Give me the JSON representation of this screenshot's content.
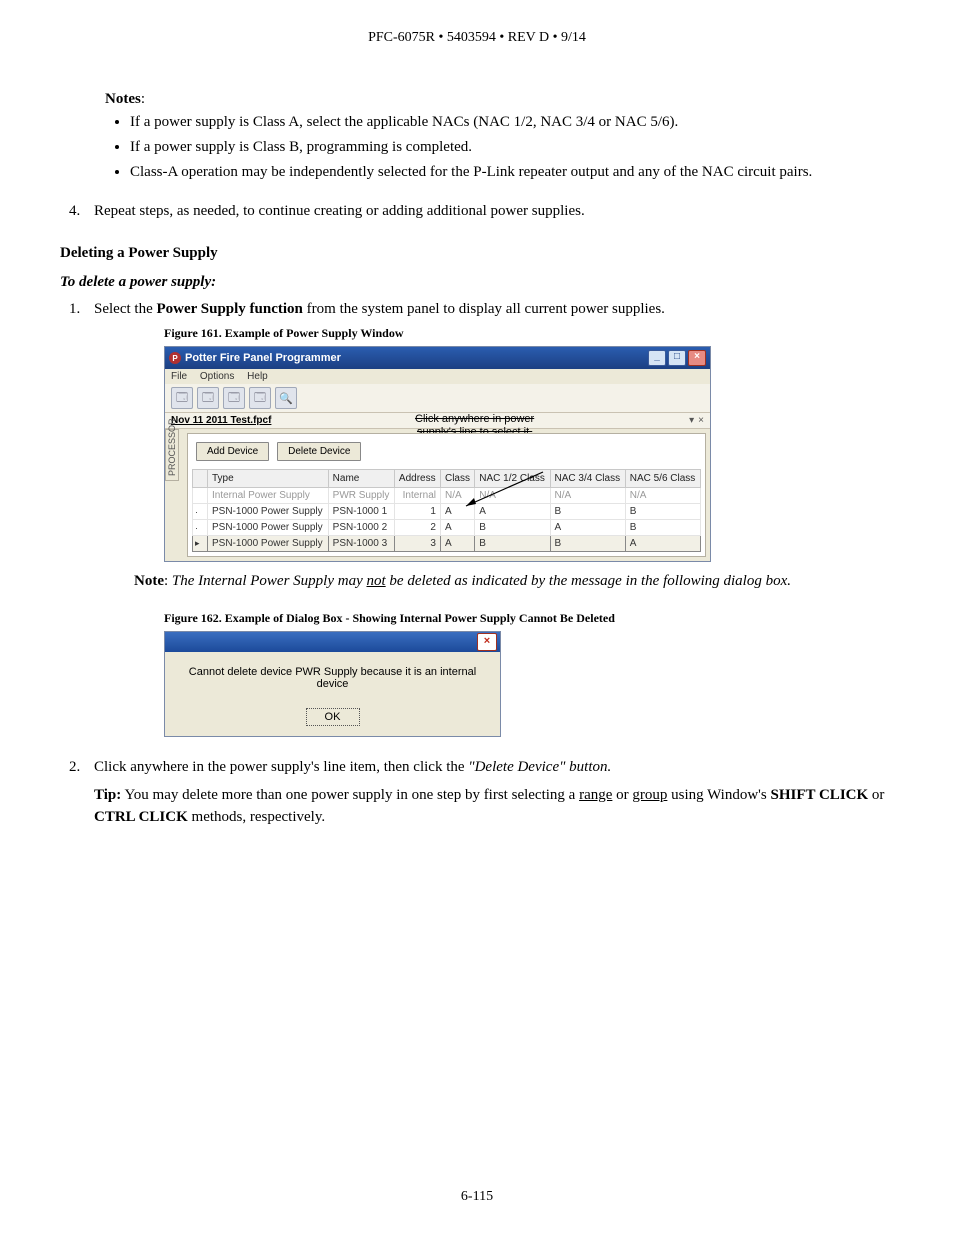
{
  "header": "PFC-6075R • 5403594 • REV D • 9/14",
  "notesLabel": "Notes",
  "notes": [
    "If a power supply is Class A, select the applicable NACs (NAC 1/2, NAC 3/4 or NAC 5/6).",
    "If a power supply is Class B, programming is completed.",
    "Class-A operation may be independently selected for the P-Link repeater output and any of the NAC circuit pairs."
  ],
  "step4": "Repeat steps, as needed, to continue creating or adding additional power supplies.",
  "deleteHeading": "Deleting a Power Supply",
  "deleteSub": "To delete a power supply:",
  "step1a": "Select the ",
  "step1b": "Power Supply function",
  "step1c": " from the system panel to display all current power supplies.",
  "fig161": "Figure 161. Example of  Power Supply Window",
  "app": {
    "title": "Potter Fire Panel Programmer",
    "menu": {
      "file": "File",
      "options": "Options",
      "help": "Help"
    },
    "doc": "Nov 11 2011 Test.fpcf",
    "calloutL1": "Click anywhere in power",
    "calloutL2": "supply's line to select it.",
    "sideTab": "PROCESSOR",
    "addBtn": "Add Device",
    "delBtn": "Delete Device",
    "cols": {
      "type": "Type",
      "name": "Name",
      "addr": "Address",
      "class": "Class",
      "n12": "NAC 1/2 Class",
      "n34": "NAC 3/4 Class",
      "n56": "NAC 5/6 Class"
    },
    "rows": [
      {
        "ind": "",
        "type": "Internal Power Supply",
        "name": "PWR Supply",
        "addr": "Internal",
        "class": "N/A",
        "n12": "N/A",
        "n34": "N/A",
        "n56": "N/A",
        "dim": true
      },
      {
        "ind": "·",
        "type": "PSN-1000 Power Supply",
        "name": "PSN-1000 1",
        "addr": "1",
        "class": "A",
        "n12": "A",
        "n34": "B",
        "n56": "B"
      },
      {
        "ind": "·",
        "type": "PSN-1000 Power Supply",
        "name": "PSN-1000 2",
        "addr": "2",
        "class": "A",
        "n12": "B",
        "n34": "A",
        "n56": "B"
      },
      {
        "ind": "▸",
        "type": "PSN-1000 Power Supply",
        "name": "PSN-1000 3",
        "addr": "3",
        "class": "A",
        "n12": "B",
        "n34": "B",
        "n56": "A",
        "sel": true
      }
    ]
  },
  "noteLabel": "Note",
  "noteText": "The Internal Power Supply may ",
  "noteNot": "not",
  "noteText2": " be deleted as indicated by the message in the following dialog box.",
  "fig162": "Figure 162. Example of Dialog Box - Showing Internal Power Supply Cannot Be Deleted",
  "dlg": {
    "msg": "Cannot delete device PWR Supply because it is an internal device",
    "ok": "OK"
  },
  "step2a": "Click anywhere in the power supply's line item, then click the ",
  "step2b": "\"Delete Device\" button.",
  "tipLabel": "Tip:",
  "tipA": "  You may delete more than one power supply in one step by first selecting a ",
  "tipRange": "range",
  "tipOr": " or ",
  "tipGroup": "group",
  "tipB": " using Window's ",
  "tipShift": "SHIFT CLICK",
  "tipOr2": " or ",
  "tipCtrl": "CTRL CLICK",
  "tipC": " methods, respectively.",
  "pageNum": "6-115"
}
